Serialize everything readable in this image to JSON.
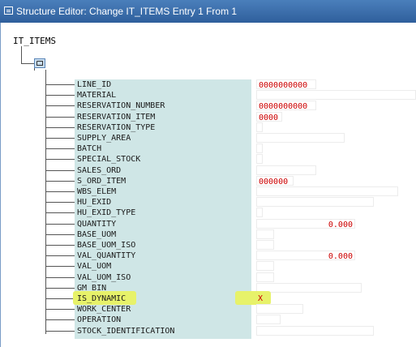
{
  "window": {
    "title": "Structure Editor: Change IT_ITEMS Entry 1 From 1"
  },
  "tree": {
    "root": "IT_ITEMS",
    "fields": [
      {
        "name": "LINE_ID",
        "value": "0000000000"
      },
      {
        "name": "MATERIAL",
        "value": ""
      },
      {
        "name": "RESERVATION_NUMBER",
        "value": "0000000000"
      },
      {
        "name": "RESERVATION_ITEM",
        "value": "0000"
      },
      {
        "name": "RESERVATION_TYPE",
        "value": ""
      },
      {
        "name": "SUPPLY_AREA",
        "value": ""
      },
      {
        "name": "BATCH",
        "value": ""
      },
      {
        "name": "SPECIAL_STOCK",
        "value": ""
      },
      {
        "name": "SALES_ORD",
        "value": ""
      },
      {
        "name": "S_ORD_ITEM",
        "value": "000000"
      },
      {
        "name": "WBS_ELEM",
        "value": ""
      },
      {
        "name": "HU_EXID",
        "value": ""
      },
      {
        "name": "HU_EXID_TYPE",
        "value": ""
      },
      {
        "name": "QUANTITY",
        "value": "0.000"
      },
      {
        "name": "BASE_UOM",
        "value": ""
      },
      {
        "name": "BASE_UOM_ISO",
        "value": ""
      },
      {
        "name": "VAL_QUANTITY",
        "value": "0.000"
      },
      {
        "name": "VAL_UOM",
        "value": ""
      },
      {
        "name": "VAL_UOM_ISO",
        "value": ""
      },
      {
        "name": "GM_BIN",
        "value": ""
      },
      {
        "name": "IS_DYNAMIC",
        "value": "X"
      },
      {
        "name": "WORK_CENTER",
        "value": ""
      },
      {
        "name": "OPERATION",
        "value": ""
      },
      {
        "name": "STOCK_IDENTIFICATION",
        "value": ""
      }
    ]
  },
  "colors": {
    "name_column": "#cfe6e6",
    "highlight": "#e7f26a",
    "value_text": "#cc0000",
    "title_bar": "#3b6da9"
  }
}
